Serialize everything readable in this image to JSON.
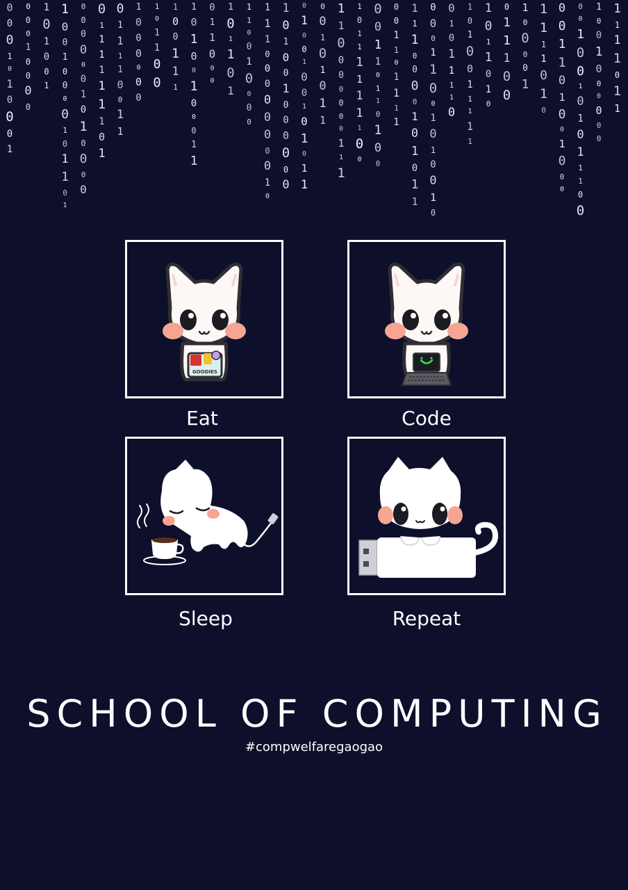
{
  "colors": {
    "background": "#0d0f2b",
    "foreground": "#ffffff",
    "cheek": "#f5a592",
    "screen_glow": "#3ddc57"
  },
  "binary_rain": {
    "digits": "0 1",
    "description_icon": "binary-code-rain"
  },
  "panels": [
    {
      "label": "Eat",
      "icon": "cat-holding-goodies-icon",
      "badge_text": "GOODIES"
    },
    {
      "label": "Code",
      "icon": "cat-with-laptop-icon"
    },
    {
      "label": "Sleep",
      "icon": "sleeping-cat-charging-icon"
    },
    {
      "label": "Repeat",
      "icon": "cat-on-usb-drive-icon"
    }
  ],
  "title": "SCHOOL OF COMPUTING",
  "hashtag": "#compwelfaregaogao"
}
